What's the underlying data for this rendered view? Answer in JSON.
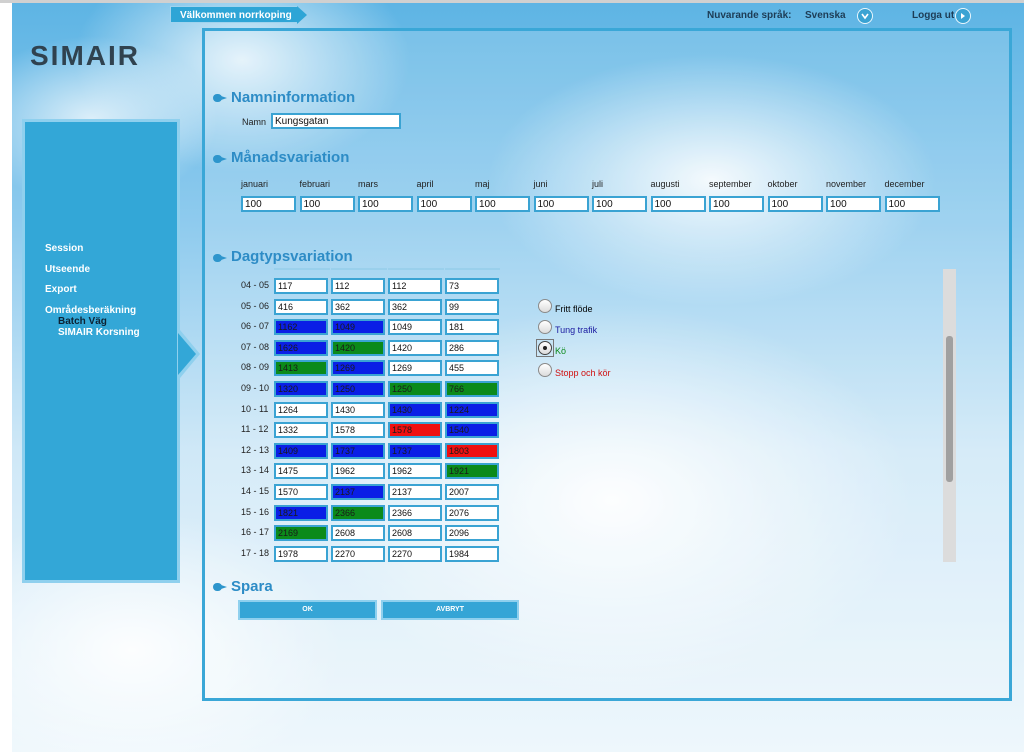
{
  "header": {
    "welcome": "Välkommen norrkoping",
    "language_label": "Nuvarande språk:",
    "language_value": "Svenska",
    "logout_label": "Logga ut"
  },
  "logo": "SIMAIR",
  "nav": {
    "items": [
      "Session",
      "Utseende",
      "Export",
      "Områdesberäkning"
    ],
    "subitems": [
      "Batch Väg",
      "SIMAIR Korsning"
    ]
  },
  "sections": {
    "name_info": "Namninformation",
    "monthly": "Månadsvariation",
    "daytype": "Dagtypsvariation",
    "save": "Spara"
  },
  "name_field": {
    "label": "Namn",
    "value": "Kungsgatan"
  },
  "months": [
    {
      "label": "januari",
      "value": "100"
    },
    {
      "label": "februari",
      "value": "100"
    },
    {
      "label": "mars",
      "value": "100"
    },
    {
      "label": "april",
      "value": "100"
    },
    {
      "label": "maj",
      "value": "100"
    },
    {
      "label": "juni",
      "value": "100"
    },
    {
      "label": "juli",
      "value": "100"
    },
    {
      "label": "augusti",
      "value": "100"
    },
    {
      "label": "september",
      "value": "100"
    },
    {
      "label": "oktober",
      "value": "100"
    },
    {
      "label": "november",
      "value": "100"
    },
    {
      "label": "december",
      "value": "100"
    }
  ],
  "status_colors": {
    "fritt": "#ffffff",
    "tung": "#0a1ee6",
    "ko": "#0b8a1a",
    "stopp": "#f01010"
  },
  "day_rows": [
    {
      "label": "04 - 05",
      "cells": [
        {
          "v": "117",
          "s": "fritt"
        },
        {
          "v": "112",
          "s": "fritt"
        },
        {
          "v": "112",
          "s": "fritt"
        },
        {
          "v": "73",
          "s": "fritt"
        }
      ]
    },
    {
      "label": "05 - 06",
      "cells": [
        {
          "v": "416",
          "s": "fritt"
        },
        {
          "v": "362",
          "s": "fritt"
        },
        {
          "v": "362",
          "s": "fritt"
        },
        {
          "v": "99",
          "s": "fritt"
        }
      ]
    },
    {
      "label": "06 - 07",
      "cells": [
        {
          "v": "1162",
          "s": "tung"
        },
        {
          "v": "1049",
          "s": "tung"
        },
        {
          "v": "1049",
          "s": "fritt"
        },
        {
          "v": "181",
          "s": "fritt"
        }
      ]
    },
    {
      "label": "07 - 08",
      "cells": [
        {
          "v": "1626",
          "s": "tung"
        },
        {
          "v": "1420",
          "s": "ko"
        },
        {
          "v": "1420",
          "s": "fritt"
        },
        {
          "v": "286",
          "s": "fritt"
        }
      ]
    },
    {
      "label": "08 - 09",
      "cells": [
        {
          "v": "1413",
          "s": "ko"
        },
        {
          "v": "1269",
          "s": "tung"
        },
        {
          "v": "1269",
          "s": "fritt"
        },
        {
          "v": "455",
          "s": "fritt"
        }
      ]
    },
    {
      "label": "09 - 10",
      "cells": [
        {
          "v": "1320",
          "s": "tung"
        },
        {
          "v": "1250",
          "s": "tung"
        },
        {
          "v": "1250",
          "s": "ko"
        },
        {
          "v": "766",
          "s": "ko"
        }
      ]
    },
    {
      "label": "10 - 11",
      "cells": [
        {
          "v": "1264",
          "s": "fritt"
        },
        {
          "v": "1430",
          "s": "fritt"
        },
        {
          "v": "1430",
          "s": "tung"
        },
        {
          "v": "1224",
          "s": "tung"
        }
      ]
    },
    {
      "label": "11 - 12",
      "cells": [
        {
          "v": "1332",
          "s": "fritt"
        },
        {
          "v": "1578",
          "s": "fritt"
        },
        {
          "v": "1578",
          "s": "stopp"
        },
        {
          "v": "1540",
          "s": "tung"
        }
      ]
    },
    {
      "label": "12 - 13",
      "cells": [
        {
          "v": "1409",
          "s": "tung"
        },
        {
          "v": "1737",
          "s": "tung"
        },
        {
          "v": "1737",
          "s": "tung"
        },
        {
          "v": "1803",
          "s": "stopp"
        }
      ]
    },
    {
      "label": "13 - 14",
      "cells": [
        {
          "v": "1475",
          "s": "fritt"
        },
        {
          "v": "1962",
          "s": "fritt"
        },
        {
          "v": "1962",
          "s": "fritt"
        },
        {
          "v": "1921",
          "s": "ko"
        }
      ]
    },
    {
      "label": "14 - 15",
      "cells": [
        {
          "v": "1570",
          "s": "fritt"
        },
        {
          "v": "2137",
          "s": "tung"
        },
        {
          "v": "2137",
          "s": "fritt"
        },
        {
          "v": "2007",
          "s": "fritt"
        }
      ]
    },
    {
      "label": "15 - 16",
      "cells": [
        {
          "v": "1821",
          "s": "tung"
        },
        {
          "v": "2366",
          "s": "ko"
        },
        {
          "v": "2366",
          "s": "fritt"
        },
        {
          "v": "2076",
          "s": "fritt"
        }
      ]
    },
    {
      "label": "16 - 17",
      "cells": [
        {
          "v": "2169",
          "s": "ko"
        },
        {
          "v": "2608",
          "s": "fritt"
        },
        {
          "v": "2608",
          "s": "fritt"
        },
        {
          "v": "2096",
          "s": "fritt"
        }
      ]
    },
    {
      "label": "17 - 18",
      "cells": [
        {
          "v": "1978",
          "s": "fritt"
        },
        {
          "v": "2270",
          "s": "fritt"
        },
        {
          "v": "2270",
          "s": "fritt"
        },
        {
          "v": "1984",
          "s": "fritt"
        }
      ]
    }
  ],
  "legend": [
    {
      "label": "Fritt flöde",
      "color": "#000000",
      "checked": false
    },
    {
      "label": "Tung trafik",
      "color": "#1a1aa0",
      "checked": false
    },
    {
      "label": "Kö",
      "color": "#0b8a1a",
      "checked": true
    },
    {
      "label": "Stopp och kör",
      "color": "#d01010",
      "checked": false
    }
  ],
  "buttons": {
    "ok": "OK",
    "cancel": "AVBRYT"
  },
  "icons": {
    "language": "chevron-down-icon",
    "logout": "arrow-right-icon"
  },
  "theme": {
    "accent": "#33a7d7",
    "title": "#2d8cc6"
  }
}
